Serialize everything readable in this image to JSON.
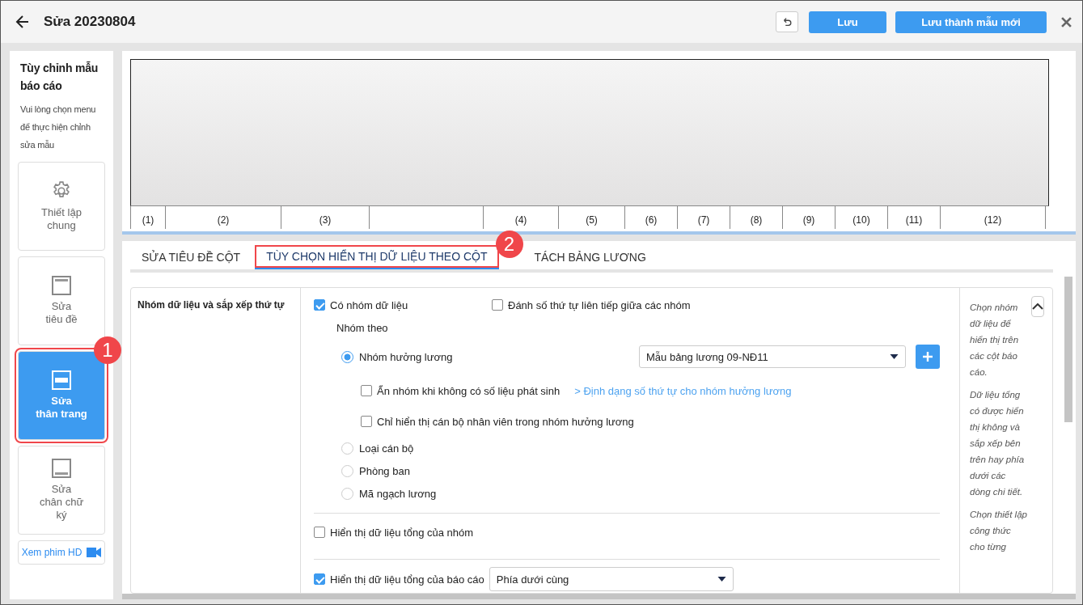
{
  "header": {
    "title": "Sửa 20230804",
    "save": "Lưu",
    "save_as": "Lưu thành mẫu mới"
  },
  "sidebar": {
    "title": "Tùy chỉnh mẫu báo cáo",
    "hint": "Vui lòng chọn menu để thực hiện chỉnh sửa mẫu",
    "items": [
      {
        "kind": "gear",
        "lines": [
          "Thiết lập",
          "chung"
        ],
        "selected": false
      },
      {
        "kind": "header",
        "lines": [
          "Sửa",
          "tiêu đề"
        ],
        "selected": false
      },
      {
        "kind": "body",
        "lines": [
          "Sửa",
          "thân trang"
        ],
        "selected": true,
        "callout": "1"
      },
      {
        "kind": "footer",
        "lines": [
          "Sửa",
          "chân chữ",
          "ký"
        ],
        "selected": false
      }
    ],
    "video_link": "Xem phim HD"
  },
  "preview": {
    "columns": [
      {
        "label": "(1)"
      },
      {
        "label": "(2)"
      },
      {
        "label": "(3)"
      },
      {},
      {
        "label": "(4)"
      },
      {
        "label": "(5)"
      },
      {
        "label": "(6)"
      },
      {
        "label": "(7)"
      },
      {
        "label": "(8)"
      },
      {
        "label": "(9)"
      },
      {
        "label": "(10)"
      },
      {
        "label": "(11)"
      },
      {
        "label": "(12)"
      }
    ]
  },
  "tabs": [
    {
      "label": "SỬA TIÊU ĐỀ CỘT",
      "selected": false
    },
    {
      "label": "TÙY CHỌN HIỂN THỊ DỮ LIỆU THEO CỘT",
      "selected": true,
      "callout": "2"
    },
    {
      "label": "TÁCH BẢNG LƯƠNG",
      "selected": false
    }
  ],
  "section": {
    "label": "Nhóm dữ liệu và sắp xếp thứ tự",
    "has_group": {
      "label": "Có nhóm dữ liệu",
      "checked": true
    },
    "continuous_numbering": {
      "label": "Đánh số thứ tự liên tiếp giữa các nhóm",
      "checked": false
    },
    "group_by_label": "Nhóm theo",
    "group_by": [
      {
        "label": "Nhóm hưởng lương",
        "selected": true
      },
      {
        "label": "Loại cán bộ",
        "selected": false
      },
      {
        "label": "Phòng ban",
        "selected": false
      },
      {
        "label": "Mã ngạch lương",
        "selected": false
      }
    ],
    "template_dropdown": {
      "value": "Mẫu bảng lương 09-NĐ11"
    },
    "sub_options": [
      {
        "label": "Ẩn nhóm khi không có số liệu phát sinh",
        "checked": false,
        "link": "> Định dạng số thứ tự cho nhóm hưởng lương"
      },
      {
        "label": "Chỉ hiển thị cán bộ nhân viên trong nhóm hưởng lương",
        "checked": false
      }
    ],
    "group_total": {
      "label": "Hiển thị dữ liệu tổng của nhóm",
      "checked": false
    },
    "report_total": {
      "label": "Hiển thị dữ liệu tổng của báo cáo",
      "checked": true,
      "position": "Phía dưới cùng"
    },
    "help": [
      "Chọn nhóm dữ liệu để hiển thị trên các cột báo cáo.",
      "Dữ liệu tổng có được hiển thị không và sắp xếp bên trên hay phía dưới các dòng chi tiết.",
      "Chọn thiết lập công thức cho từng"
    ]
  }
}
